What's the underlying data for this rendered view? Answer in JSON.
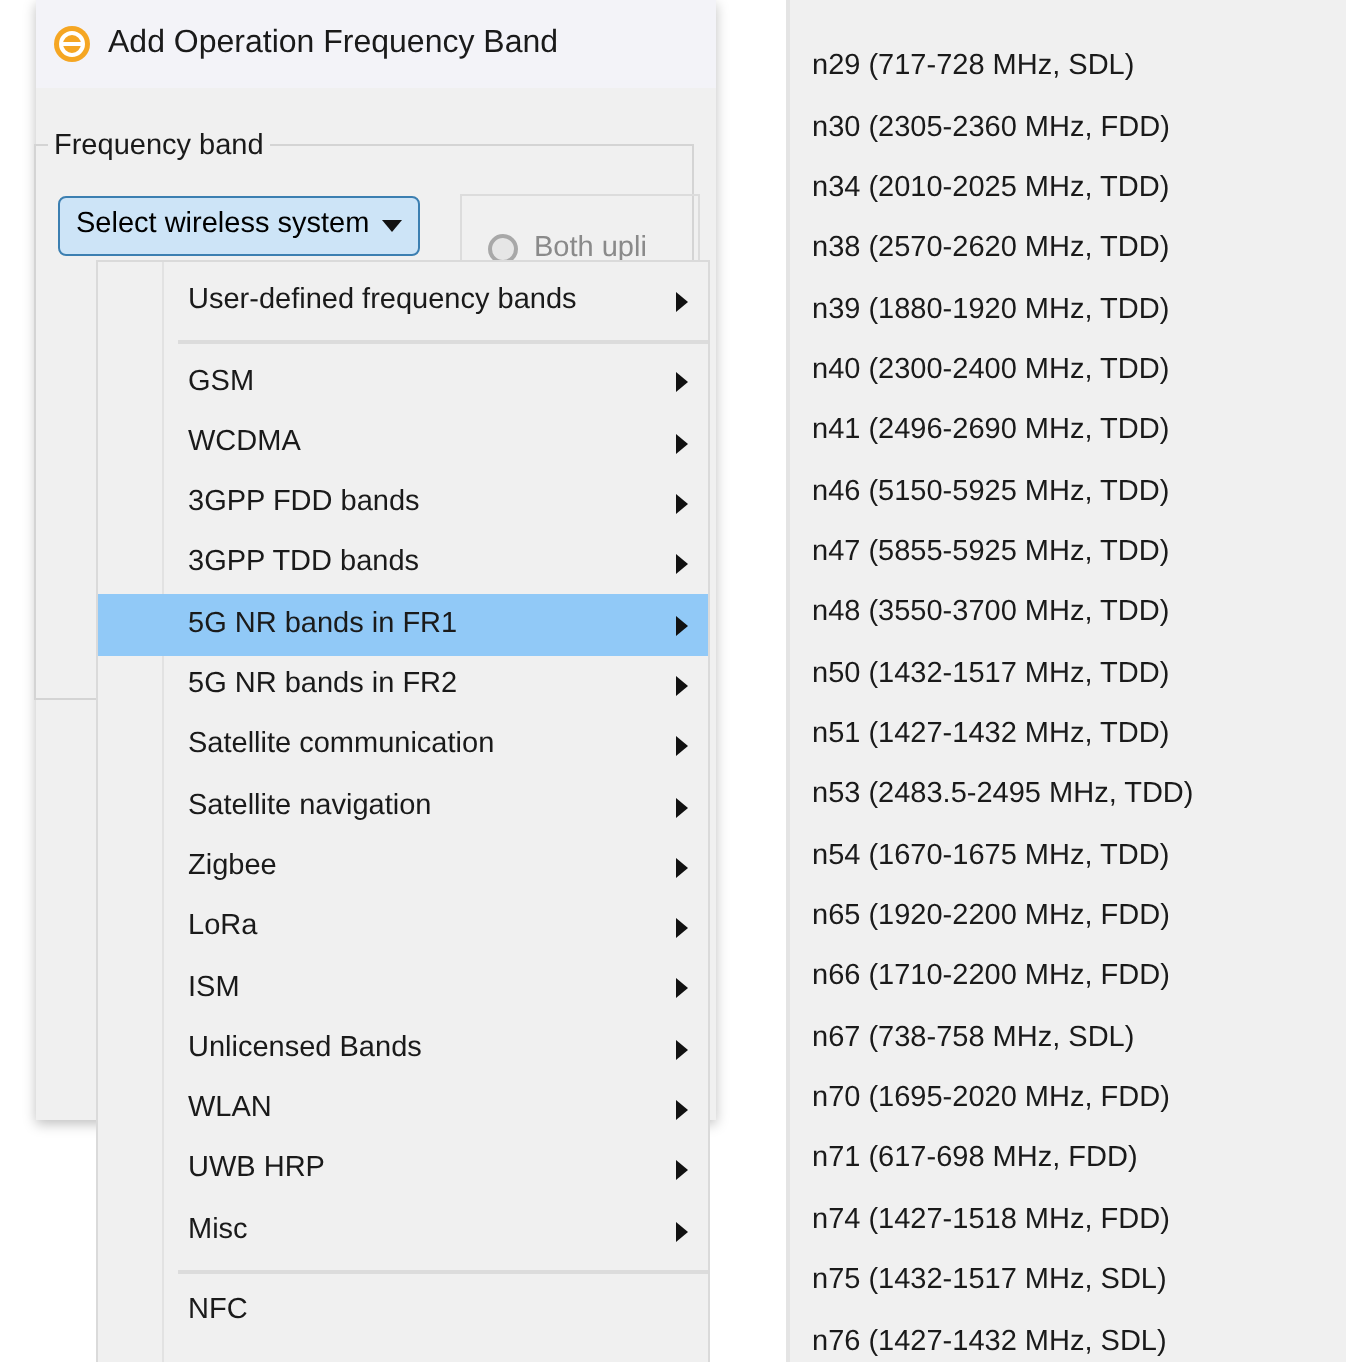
{
  "dialog": {
    "title": "Add Operation Frequency Band",
    "group_label": "Frequency band",
    "dropdown_button": "Select wireless system",
    "radio": {
      "label": "Both upli",
      "checked": false,
      "disabled": true
    }
  },
  "menu": {
    "items": [
      {
        "kind": "submenu",
        "label": "User-defined frequency bands",
        "selected": false
      },
      {
        "kind": "separator"
      },
      {
        "kind": "submenu",
        "label": "GSM",
        "selected": false
      },
      {
        "kind": "submenu",
        "label": "WCDMA",
        "selected": false
      },
      {
        "kind": "submenu",
        "label": "3GPP FDD bands",
        "selected": false
      },
      {
        "kind": "submenu",
        "label": "3GPP TDD bands",
        "selected": false
      },
      {
        "kind": "submenu",
        "label": "5G NR bands in FR1",
        "selected": true
      },
      {
        "kind": "submenu",
        "label": "5G NR bands in FR2",
        "selected": false
      },
      {
        "kind": "submenu",
        "label": "Satellite communication",
        "selected": false
      },
      {
        "kind": "submenu",
        "label": "Satellite navigation",
        "selected": false
      },
      {
        "kind": "submenu",
        "label": "Zigbee",
        "selected": false
      },
      {
        "kind": "submenu",
        "label": "LoRa",
        "selected": false
      },
      {
        "kind": "submenu",
        "label": "ISM",
        "selected": false
      },
      {
        "kind": "submenu",
        "label": "Unlicensed Bands",
        "selected": false
      },
      {
        "kind": "submenu",
        "label": "WLAN",
        "selected": false
      },
      {
        "kind": "submenu",
        "label": "UWB HRP",
        "selected": false
      },
      {
        "kind": "submenu",
        "label": "Misc",
        "selected": false
      },
      {
        "kind": "separator"
      },
      {
        "kind": "item",
        "label": "NFC",
        "selected": false
      }
    ]
  },
  "submenu": {
    "items": [
      "n29 (717-728 MHz, SDL)",
      "n30 (2305-2360 MHz, FDD)",
      "n34 (2010-2025 MHz, TDD)",
      "n38 (2570-2620 MHz, TDD)",
      "n39 (1880-1920 MHz, TDD)",
      "n40 (2300-2400 MHz, TDD)",
      "n41 (2496-2690 MHz, TDD)",
      "n46 (5150-5925 MHz, TDD)",
      "n47 (5855-5925 MHz, TDD)",
      "n48 (3550-3700 MHz, TDD)",
      "n50 (1432-1517 MHz, TDD)",
      "n51 (1427-1432 MHz, TDD)",
      "n53 (2483.5-2495 MHz, TDD)",
      "n54 (1670-1675 MHz, TDD)",
      "n65 (1920-2200 MHz, FDD)",
      "n66 (1710-2200 MHz, FDD)",
      "n67 (738-758 MHz, SDL)",
      "n70 (1695-2020 MHz, FDD)",
      "n71 (617-698 MHz, FDD)",
      "n74 (1427-1518 MHz, FDD)",
      "n75 (1432-1517 MHz, SDL)",
      "n76 (1427-1432 MHz, SDL)"
    ]
  }
}
